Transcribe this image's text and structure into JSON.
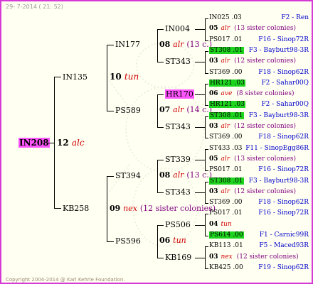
{
  "header": {
    "date": "29-  7-2014 ( 21: 52)"
  },
  "footer": {
    "copyright": "Copyright 2004-2014 @ Karl Kehrle Foundation."
  },
  "queen": {
    "name": "IN208",
    "num": "12",
    "rasse": "alc"
  },
  "gen1": {
    "father": {
      "name": "IN135",
      "num": "10",
      "rasse": "tun"
    },
    "mother": {
      "name": "KB258",
      "num": "09",
      "rasse": "nex",
      "note": "(12 sister colonies)"
    }
  },
  "gen2": {
    "ff": {
      "name": "IN177",
      "num": "08",
      "rasse": "alr",
      "note": "(13 c.)"
    },
    "fm": {
      "name": "PS589",
      "num": "07",
      "rasse": "alr",
      "note": "(14 c.)"
    },
    "mf": {
      "name": "ST394",
      "num": "08",
      "rasse": "alr",
      "note": "(13 c.)"
    },
    "mm": {
      "name": "PS596",
      "num": "06",
      "rasse": "tun"
    }
  },
  "gen3": {
    "a": "IN004",
    "b": "ST343",
    "c": "HR170",
    "d": "ST343",
    "e": "ST339",
    "f": "ST343",
    "g": "PS506",
    "h": "KB169"
  },
  "rows": [
    {
      "id": "IN025 .03",
      "loc": "F2 - Ren"
    },
    {
      "num": "05",
      "rasse": "alr",
      "note": "(13 sister colonies)"
    },
    {
      "id": "PS017 .01",
      "loc": "F16 - Sinop72R"
    },
    {
      "id": "ST308 .01",
      "loc": "F3 - Bayburt98-3R",
      "hl": "lime"
    },
    {
      "num": "03",
      "rasse": "alr",
      "note": "(12 sister colonies)"
    },
    {
      "id": "ST369 .00",
      "loc": "F18 - Sinop62R"
    },
    {
      "id": "HR121 .03",
      "loc": "F2 - Sahar00Q",
      "hl": "lime"
    },
    {
      "num": "06",
      "rasse": "ave",
      "note": "(8 sister colonies)"
    },
    {
      "id": "HR121 .03",
      "loc": "F2 - Sahar00Q",
      "hl": "lime"
    },
    {
      "id": "ST308 .01",
      "loc": "F3 - Bayburt98-3R",
      "hl": "lime"
    },
    {
      "num": "03",
      "rasse": "alr",
      "note": "(12 sister colonies)"
    },
    {
      "id": "ST369 .00",
      "loc": "F18 - Sinop62R"
    },
    {
      "id": "ST433 .03",
      "loc": "F11 - SinopEgg86R"
    },
    {
      "num": "05",
      "rasse": "alr",
      "note": "(13 sister colonies)"
    },
    {
      "id": "PS017 .01",
      "loc": "F16 - Sinop72R"
    },
    {
      "id": "ST308 .01",
      "loc": "F3 - Bayburt98-3R",
      "hl": "lime"
    },
    {
      "num": "03",
      "rasse": "alr",
      "note": "(12 sister colonies)"
    },
    {
      "id": "ST369 .00",
      "loc": "F18 - Sinop62R"
    },
    {
      "id": "PS017 .01",
      "loc": "F16 - Sinop72R"
    },
    {
      "num": "04",
      "rasse": "tun",
      "note": ""
    },
    {
      "id": "PS614 .00",
      "loc": "F1 - Carnic99R",
      "hl": "lime"
    },
    {
      "id": "KB113 .01",
      "loc": "F5 - Maced93R"
    },
    {
      "num": "03",
      "rasse": "nex",
      "note": "(12 sister colonies)"
    },
    {
      "id": "KB425 .00",
      "loc": "F19 - Sinop62R"
    }
  ]
}
